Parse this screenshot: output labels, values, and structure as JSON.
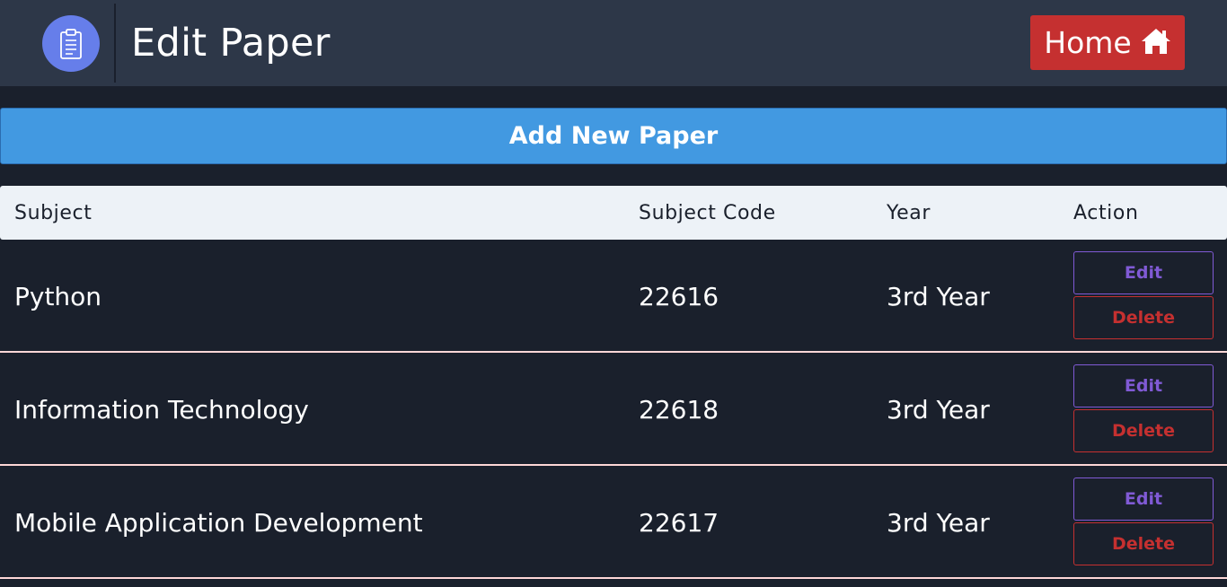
{
  "header": {
    "title": "Edit Paper",
    "logo_icon": "clipboard-icon",
    "home_label": "Home",
    "home_icon": "home-icon"
  },
  "add_button_label": "Add New Paper",
  "table": {
    "columns": [
      "Subject",
      "Subject Code",
      "Year",
      "Action"
    ],
    "rows": [
      {
        "subject": "Python",
        "code": "22616",
        "year": "3rd Year"
      },
      {
        "subject": "Information Technology",
        "code": "22618",
        "year": "3rd Year"
      },
      {
        "subject": "Mobile Application Development",
        "code": "22617",
        "year": "3rd Year"
      }
    ],
    "edit_label": "Edit",
    "delete_label": "Delete"
  },
  "colors": {
    "background": "#1a202c",
    "header": "#2d3748",
    "logo": "#667eea",
    "home_button": "#c53030",
    "add_button": "#4299e1",
    "table_header": "#edf2f7",
    "edit_accent": "#805ad5",
    "delete_accent": "#c53030",
    "row_divider": "#fed7d7"
  }
}
